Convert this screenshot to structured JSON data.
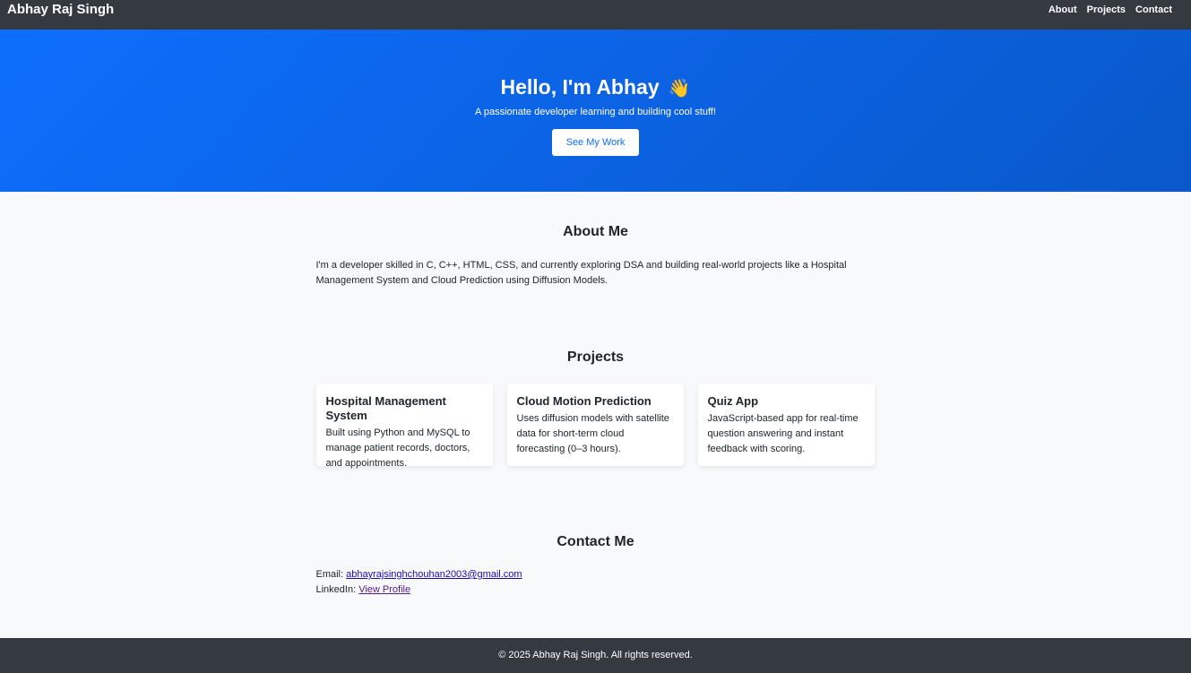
{
  "navbar": {
    "brand": "Abhay Raj Singh",
    "links": [
      "About",
      "Projects",
      "Contact"
    ]
  },
  "hero": {
    "title": "Hello, I'm Abhay",
    "wave": "👋",
    "subtitle": "A passionate developer learning and building cool stuff!",
    "button": "See My Work"
  },
  "about": {
    "heading": "About Me",
    "text": "I'm a developer skilled in C, C++, HTML, CSS, and currently exploring DSA and building real-world projects like a Hospital Management System and Cloud Prediction using Diffusion Models."
  },
  "projects": {
    "heading": "Projects",
    "items": [
      {
        "title": "Hospital Management System",
        "desc": "Built using Python and MySQL to manage patient records, doctors, and appointments."
      },
      {
        "title": "Cloud Motion Prediction",
        "desc": "Uses diffusion models with satellite data for short-term cloud forecasting (0–3 hours)."
      },
      {
        "title": "Quiz App",
        "desc": "JavaScript-based app for real-time question answering and instant feedback with scoring."
      }
    ]
  },
  "contact": {
    "heading": "Contact Me",
    "email_label": "Email: ",
    "email": "abhayrajsinghchouhan2003@gmail.com",
    "linkedin_label": "LinkedIn: ",
    "linkedin_text": "View Profile"
  },
  "footer": {
    "text": "© 2025 Abhay Raj Singh. All rights reserved."
  },
  "colors": {
    "navbar_bg": "#343a40",
    "hero_gradient_start": "#0d6efd",
    "hero_gradient_end": "#0a58ca",
    "page_bg": "#f8f9fa"
  }
}
